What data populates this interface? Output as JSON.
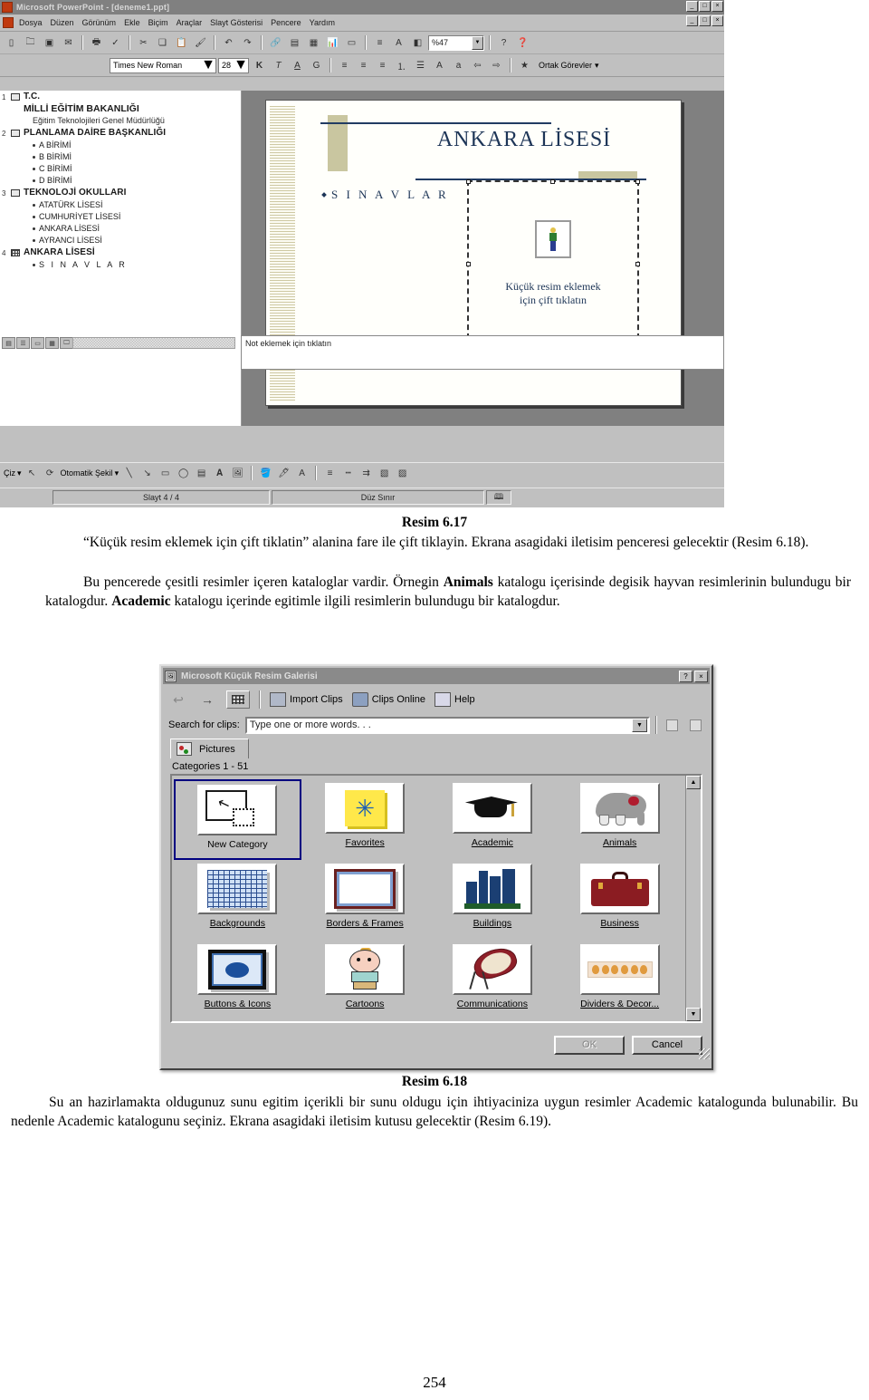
{
  "powerpoint": {
    "title": "Microsoft PowerPoint - [deneme1.ppt]",
    "window_buttons": [
      "_",
      "□",
      "×"
    ],
    "doc_window_buttons": [
      "_",
      "□",
      "×"
    ],
    "menus": [
      "Dosya",
      "Düzen",
      "Görünüm",
      "Ekle",
      "Biçim",
      "Araçlar",
      "Slayt Gösterisi",
      "Pencere",
      "Yardım"
    ],
    "zoom_value": "%47",
    "font_name": "Times New Roman",
    "font_size": "28",
    "common_tasks_label": "Ortak Görevler",
    "draw_menu_label": "Çiz",
    "autoshape_label": "Otomatik Şekil",
    "notes_placeholder": "Not eklemek için tıklatın",
    "status": {
      "slide": "Slayt 4 / 4",
      "design": "Düz Sınır"
    },
    "outline": [
      {
        "num": "1",
        "icon": "slide-icon",
        "type": "title",
        "text": "T.C."
      },
      {
        "num": "",
        "icon": "",
        "type": "title2",
        "text": "MİLLİ EĞİTİM BAKANLIĞI"
      },
      {
        "num": "",
        "icon": "",
        "type": "sub",
        "text": "Eğitim Teknolojileri Genel Müdürlüğü"
      },
      {
        "num": "2",
        "icon": "slide-icon",
        "type": "title",
        "text": "PLANLAMA DAİRE BAŞKANLIĞI"
      },
      {
        "num": "",
        "icon": "",
        "type": "bullet",
        "text": "A BİRİMİ"
      },
      {
        "num": "",
        "icon": "",
        "type": "bullet",
        "text": "B BİRİMİ"
      },
      {
        "num": "",
        "icon": "",
        "type": "bullet",
        "text": "C BİRİMİ"
      },
      {
        "num": "",
        "icon": "",
        "type": "bullet",
        "text": "D BİRİMİ"
      },
      {
        "num": "3",
        "icon": "slide-icon",
        "type": "title",
        "text": "TEKNOLOJİ OKULLARI"
      },
      {
        "num": "",
        "icon": "",
        "type": "bullet",
        "text": "ATATÜRK LİSESİ"
      },
      {
        "num": "",
        "icon": "",
        "type": "bullet",
        "text": "CUMHURİYET LİSESİ"
      },
      {
        "num": "",
        "icon": "",
        "type": "bullet",
        "text": "ANKARA LİSESİ"
      },
      {
        "num": "",
        "icon": "",
        "type": "bullet",
        "text": "AYRANCI LİSESİ"
      },
      {
        "num": "4",
        "icon": "slide-grid-icon",
        "type": "title",
        "text": "ANKARA  LİSESİ"
      },
      {
        "num": "",
        "icon": "",
        "type": "bullet-spaced",
        "text": "S I N A V L A R"
      }
    ],
    "slide": {
      "title": "ANKARA LİSESİ",
      "bullet": "S I N A V L A R",
      "placeholder_text_line1": "Küçük resim eklemek",
      "placeholder_text_line2": "için çift tıklatın"
    }
  },
  "caption_617": "Resim 6.17",
  "paragraph_1": "“Küçük resim eklemek için çift tiklatin” alanina fare ile çift tiklayin. Ekrana asagidaki iletisim penceresi gelecektir (Resim 6.18).",
  "paragraph_2": {
    "part1": "Bu pencerede çesitli resimler içeren kataloglar vardir. Örnegin ",
    "bold1": "Animals",
    "part2": " katalogu içerisinde degisik hayvan resimlerinin bulundugu bir katalogdur. ",
    "bold2": "Academic",
    "part3": " katalogu içerinde egitimle ilgili resimlerin bulundugu bir katalogdur."
  },
  "clip_gallery": {
    "title": "Microsoft Küçük Resim Galerisi",
    "help_btn": "?",
    "close_btn": "×",
    "toolbar": {
      "back": "back-arrow",
      "forward": "forward-arrow",
      "all_categories": "all-categories",
      "import_clips": "Import Clips",
      "clips_online": "Clips Online",
      "help": "Help"
    },
    "search_label": "Search for clips:",
    "search_placeholder": "Type one or more words. . .",
    "tab_label": "Pictures",
    "categories_label": "Categories 1 - 51",
    "categories": [
      {
        "name": "New Category",
        "art": "new-category",
        "selected": true
      },
      {
        "name": "Favorites",
        "art": "favorites",
        "selected": false
      },
      {
        "name": "Academic",
        "art": "academic",
        "selected": false
      },
      {
        "name": "Animals",
        "art": "animals",
        "selected": false
      },
      {
        "name": "Backgrounds",
        "art": "backgrounds",
        "selected": false
      },
      {
        "name": "Borders & Frames",
        "art": "borders-frames",
        "selected": false
      },
      {
        "name": "Buildings",
        "art": "buildings",
        "selected": false
      },
      {
        "name": "Business",
        "art": "business",
        "selected": false
      },
      {
        "name": "Buttons & Icons",
        "art": "buttons-icons",
        "selected": false
      },
      {
        "name": "Cartoons",
        "art": "cartoons",
        "selected": false
      },
      {
        "name": "Communications",
        "art": "communications",
        "selected": false
      },
      {
        "name": "Dividers & Decor...",
        "art": "dividers-decor",
        "selected": false
      }
    ],
    "ok_label": "OK",
    "cancel_label": "Cancel"
  },
  "caption_618": "Resim 6.18",
  "paragraph_3": "Su an hazirlamakta oldugunuz sunu egitim içerikli bir sunu oldugu için ihtiyaciniza uygun resimler Academic katalogunda bulunabilir. Bu nedenle Academic katalogunu seçiniz. Ekrana asagidaki iletisim kutusu gelecektir (Resim 6.19).",
  "page_number": "254"
}
